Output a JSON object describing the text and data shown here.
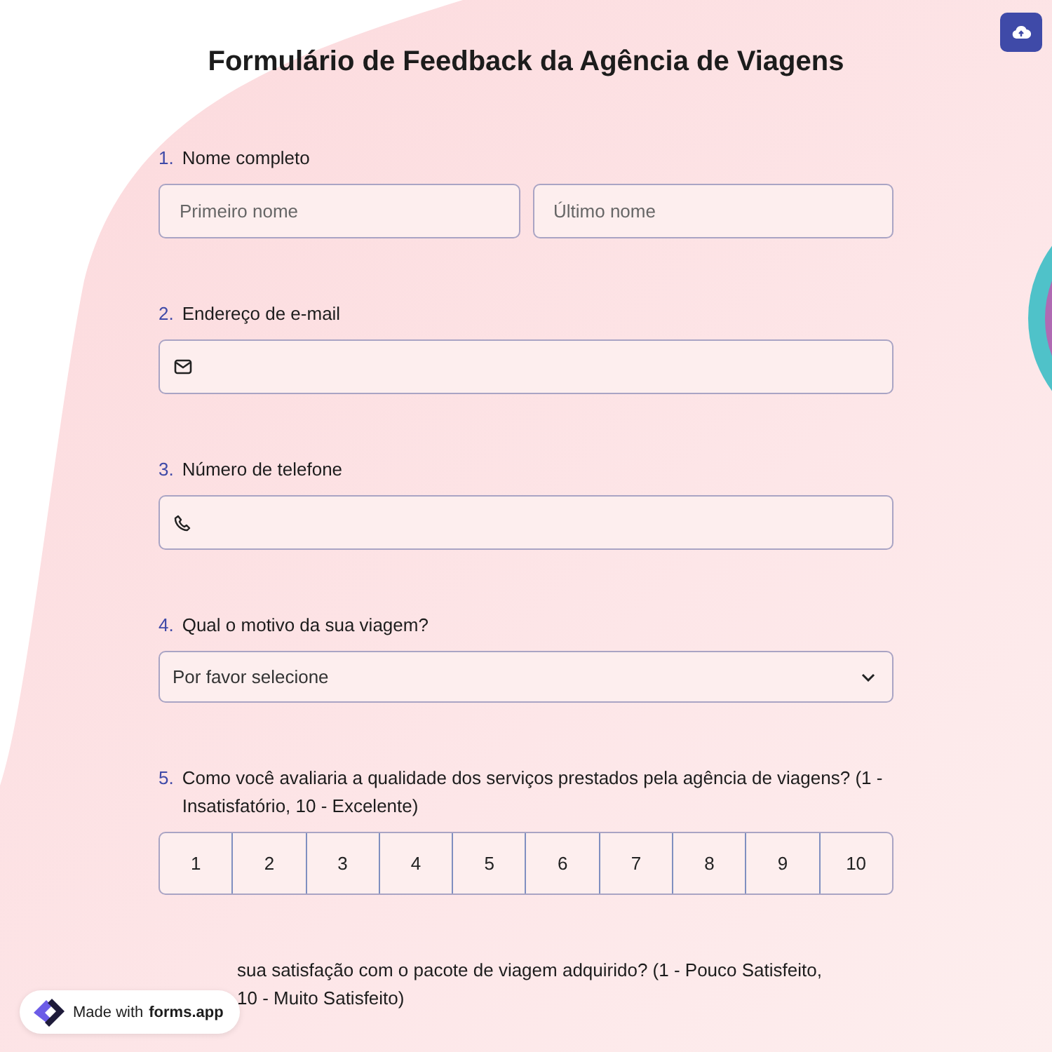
{
  "title": "Formulário de Feedback da Agência de Viagens",
  "questions": [
    {
      "kind": "name",
      "number": "1.",
      "label": "Nome completo",
      "fields": [
        {
          "placeholder": "Primeiro nome"
        },
        {
          "placeholder": "Último nome"
        }
      ]
    },
    {
      "kind": "email",
      "number": "2.",
      "label": "Endereço de e-mail"
    },
    {
      "kind": "phone",
      "number": "3.",
      "label": "Número de telefone"
    },
    {
      "kind": "select",
      "number": "4.",
      "label": "Qual o motivo da sua viagem?",
      "placeholder": "Por favor selecione"
    },
    {
      "kind": "scale",
      "number": "5.",
      "label": "Como você avaliaria a qualidade dos serviços prestados pela agência de viagens? (1 - Insatisfatório, 10 - Excelente)",
      "options": [
        "1",
        "2",
        "3",
        "4",
        "5",
        "6",
        "7",
        "8",
        "9",
        "10"
      ]
    },
    {
      "kind": "text",
      "label": "sua satisfação com o pacote de viagem adquirido? (1 - Pouco Satisfeito, 10 - Muito Satisfeito)"
    }
  ],
  "badge": {
    "text": "Made with",
    "brand": "forms.app"
  }
}
